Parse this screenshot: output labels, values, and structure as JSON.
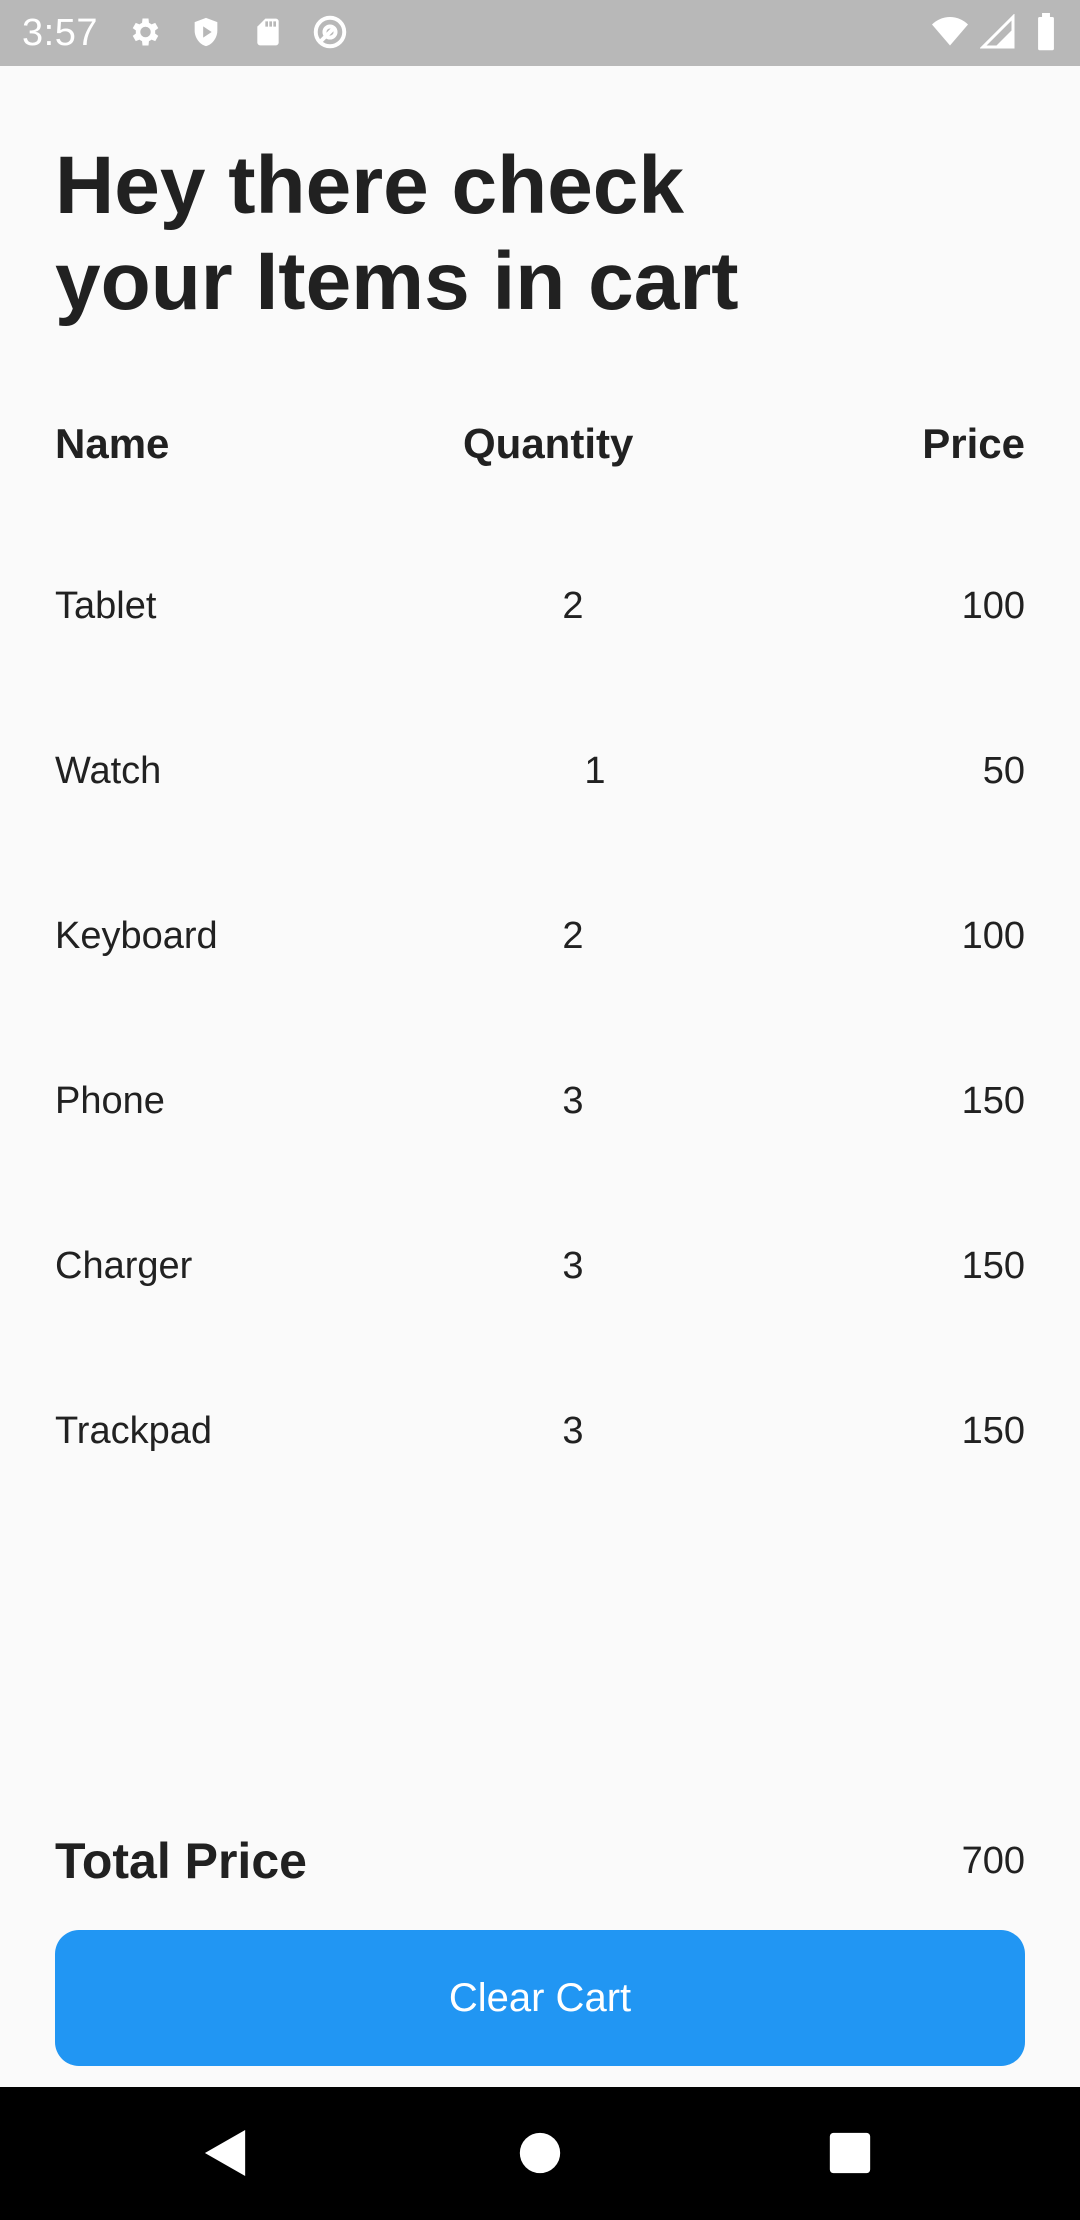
{
  "status_bar": {
    "time": "3:57",
    "left_icons": [
      "gear-icon",
      "shield-play-icon",
      "sd-card-icon",
      "at-sign-icon"
    ],
    "right_icons": [
      "wifi-icon",
      "signal-icon",
      "battery-icon"
    ]
  },
  "page": {
    "title": "Hey there check your Items in cart"
  },
  "table": {
    "headers": {
      "name": "Name",
      "quantity": "Quantity",
      "price": "Price"
    },
    "rows": [
      {
        "name": "Tablet",
        "quantity": "2",
        "price": "100"
      },
      {
        "name": "Watch",
        "quantity": "1",
        "price": "50"
      },
      {
        "name": "Keyboard",
        "quantity": "2",
        "price": "100"
      },
      {
        "name": "Phone",
        "quantity": "3",
        "price": "150"
      },
      {
        "name": "Charger",
        "quantity": "3",
        "price": "150"
      },
      {
        "name": "Trackpad",
        "quantity": "3",
        "price": "150"
      }
    ]
  },
  "total": {
    "label": "Total Price",
    "value": "700"
  },
  "actions": {
    "clear_cart_label": "Clear Cart"
  },
  "colors": {
    "accent": "#2196f3",
    "background": "#fafafa",
    "status_bar": "#b8b8b8",
    "text": "#212121"
  },
  "nav_bar": {
    "buttons": [
      "back-icon",
      "home-icon",
      "recents-icon"
    ]
  }
}
